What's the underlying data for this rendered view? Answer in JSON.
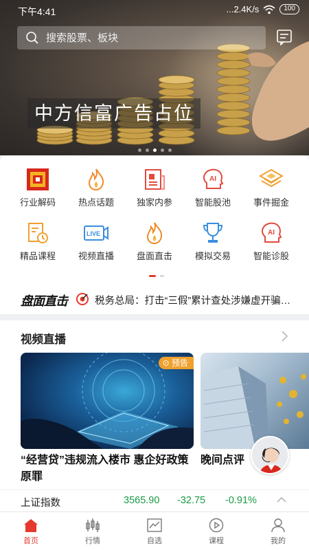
{
  "status_bar": {
    "time": "下午4:41",
    "network": "...2.4K/s",
    "battery": "100"
  },
  "search": {
    "placeholder": "搜索股票、板块"
  },
  "banner": {
    "ad_text": "中方信富广告占位",
    "slides": 5,
    "active_slide": 3
  },
  "grid": {
    "items": [
      {
        "label": "行业解码",
        "icon": "industry-decode-icon"
      },
      {
        "label": "热点话题",
        "icon": "flame-icon"
      },
      {
        "label": "独家内参",
        "icon": "document-icon"
      },
      {
        "label": "智能股池",
        "icon": "ai-head-icon"
      },
      {
        "label": "事件掘金",
        "icon": "layers-icon"
      },
      {
        "label": "精品课程",
        "icon": "course-clock-icon"
      },
      {
        "label": "视频直播",
        "icon": "live-icon"
      },
      {
        "label": "盘面直击",
        "icon": "flame-icon"
      },
      {
        "label": "模拟交易",
        "icon": "trophy-icon"
      },
      {
        "label": "智能诊股",
        "icon": "ai-head-icon"
      }
    ]
  },
  "ticker": {
    "brand": "盘面直击",
    "news": "税务总局：打击“三假”累计查处涉嫌虚开骗…"
  },
  "video_section": {
    "title": "视频直播",
    "cards": [
      {
        "badge": "预告",
        "title": "“经营贷”违规流入楼市 惠企好政策原罪"
      },
      {
        "title": "晚间点评"
      }
    ]
  },
  "index_bar": {
    "name": "上证指数",
    "price": "3565.90",
    "change": "-32.75",
    "percent": "-0.91%"
  },
  "tabbar": {
    "tabs": [
      {
        "label": "首页",
        "active": true
      },
      {
        "label": "行情"
      },
      {
        "label": "自选"
      },
      {
        "label": "课程"
      },
      {
        "label": "我的"
      }
    ]
  },
  "colors": {
    "accent": "#e53a2e",
    "down": "#1a9a45",
    "badge": "#f0a02e"
  }
}
